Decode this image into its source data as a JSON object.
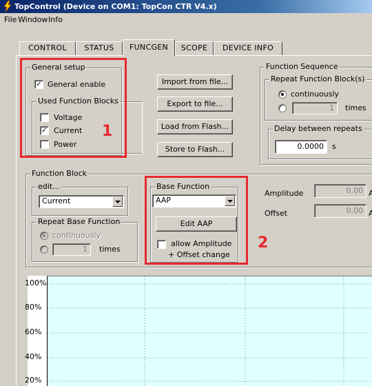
{
  "window": {
    "title": "TopControl (Device on COM1: TopCon CTR V4.x)"
  },
  "menu": [
    "File",
    "Window",
    "Info"
  ],
  "tabs": [
    {
      "label": "CONTROL",
      "active": false
    },
    {
      "label": "STATUS",
      "active": false
    },
    {
      "label": "FUNCGEN",
      "active": true
    },
    {
      "label": "SCOPE",
      "active": false
    },
    {
      "label": "DEVICE INFO",
      "active": false
    }
  ],
  "general_setup": {
    "title": "General setup",
    "general_enable": {
      "label": "General enable",
      "checked": true
    },
    "used_blocks": {
      "title": "Used Function Blocks",
      "items": [
        {
          "label": "Voltage",
          "checked": false
        },
        {
          "label": "Current",
          "checked": true
        },
        {
          "label": "Power",
          "checked": false
        }
      ]
    }
  },
  "buttons": {
    "import": "Import from file...",
    "export": "Export to file...",
    "load_flash": "Load from Flash...",
    "store_flash": "Store to Flash..."
  },
  "function_sequence": {
    "title": "Function Sequence",
    "repeat_title": "Repeat Function Block(s)",
    "continuously": "continuously",
    "times_value": "1",
    "times_label": "times",
    "delay_title": "Delay between repeats",
    "delay_value": "0.0000",
    "delay_unit": "s"
  },
  "function_block": {
    "title": "Function Block",
    "edit_title": "edit...",
    "edit_value": "Current",
    "repeat_base_title": "Repeat Base Function",
    "continuously": "continuously",
    "times_value": "1",
    "times_label": "times"
  },
  "base_function": {
    "title": "Base Function",
    "value": "AAP",
    "edit_button": "Edit AAP",
    "allow_change": {
      "label_line1": "allow Amplitude",
      "label_line2": "+ Offset change",
      "checked": false
    }
  },
  "amp_offset": {
    "amplitude_label": "Amplitude",
    "amplitude_value": "0.00",
    "amplitude_unit": "A",
    "offset_label": "Offset",
    "offset_value": "0.00",
    "offset_unit": "A"
  },
  "plot": {
    "y_ticks": [
      "100%",
      "80%",
      "60%",
      "40%",
      "20%"
    ],
    "background": "#e0ffff"
  },
  "annotations": {
    "marker1": "1",
    "marker2": "2",
    "color": "#e8282e"
  }
}
